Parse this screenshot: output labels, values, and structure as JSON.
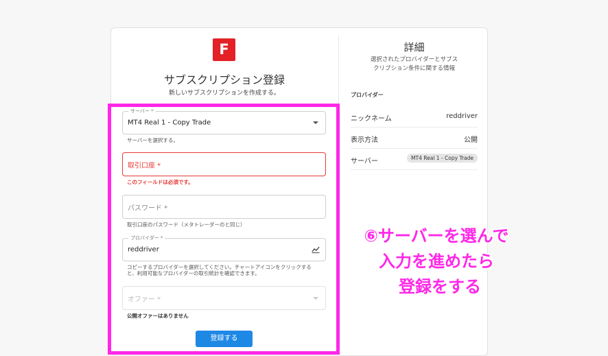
{
  "brand": {
    "logo_letter": "F",
    "logo_color": "#e32127"
  },
  "form": {
    "title": "サブスクリプション登録",
    "subtitle": "新しいサブスクリプションを作成する。",
    "server": {
      "label": "サーバー *",
      "value": "MT4 Real 1 - Copy Trade",
      "helper": "サーバーを選択する。"
    },
    "account": {
      "placeholder": "取引口座 *",
      "error": "このフィールドは必須です。"
    },
    "password": {
      "placeholder": "パスワード *",
      "helper": "取引口座のパスワード（メタトレーダーのと同じ）"
    },
    "provider": {
      "label": "プロバイダー *",
      "value": "reddriver",
      "helper_line1": "コピーするプロバイダーを選択してください。チャートアイコンをクリックする",
      "helper_line2": "と、利用可能なプロバイダーの取引統計を確認できます。"
    },
    "offer": {
      "placeholder": "オファー *",
      "helper": "公開オファーはありません"
    },
    "submit_label": "登録する"
  },
  "details": {
    "title": "詳細",
    "desc_line1": "選択されたプロバイダーとサブス",
    "desc_line2": "クリプション条件に関する情報",
    "section": "プロバイダー",
    "rows": [
      {
        "key": "ニックネーム",
        "value": "reddriver"
      },
      {
        "key": "表示方法",
        "value": "公開"
      },
      {
        "key": "サーバー",
        "value": "MT4 Real 1 - Copy Trade"
      }
    ]
  },
  "annotation": {
    "line1": "⑥サーバーを選んで",
    "line2": "入力を進めたら",
    "line3": "登録をする",
    "color": "#ff27e8"
  },
  "colors": {
    "primary": "#1e88e5",
    "error": "#e53935",
    "highlight": "#ff27e8"
  }
}
